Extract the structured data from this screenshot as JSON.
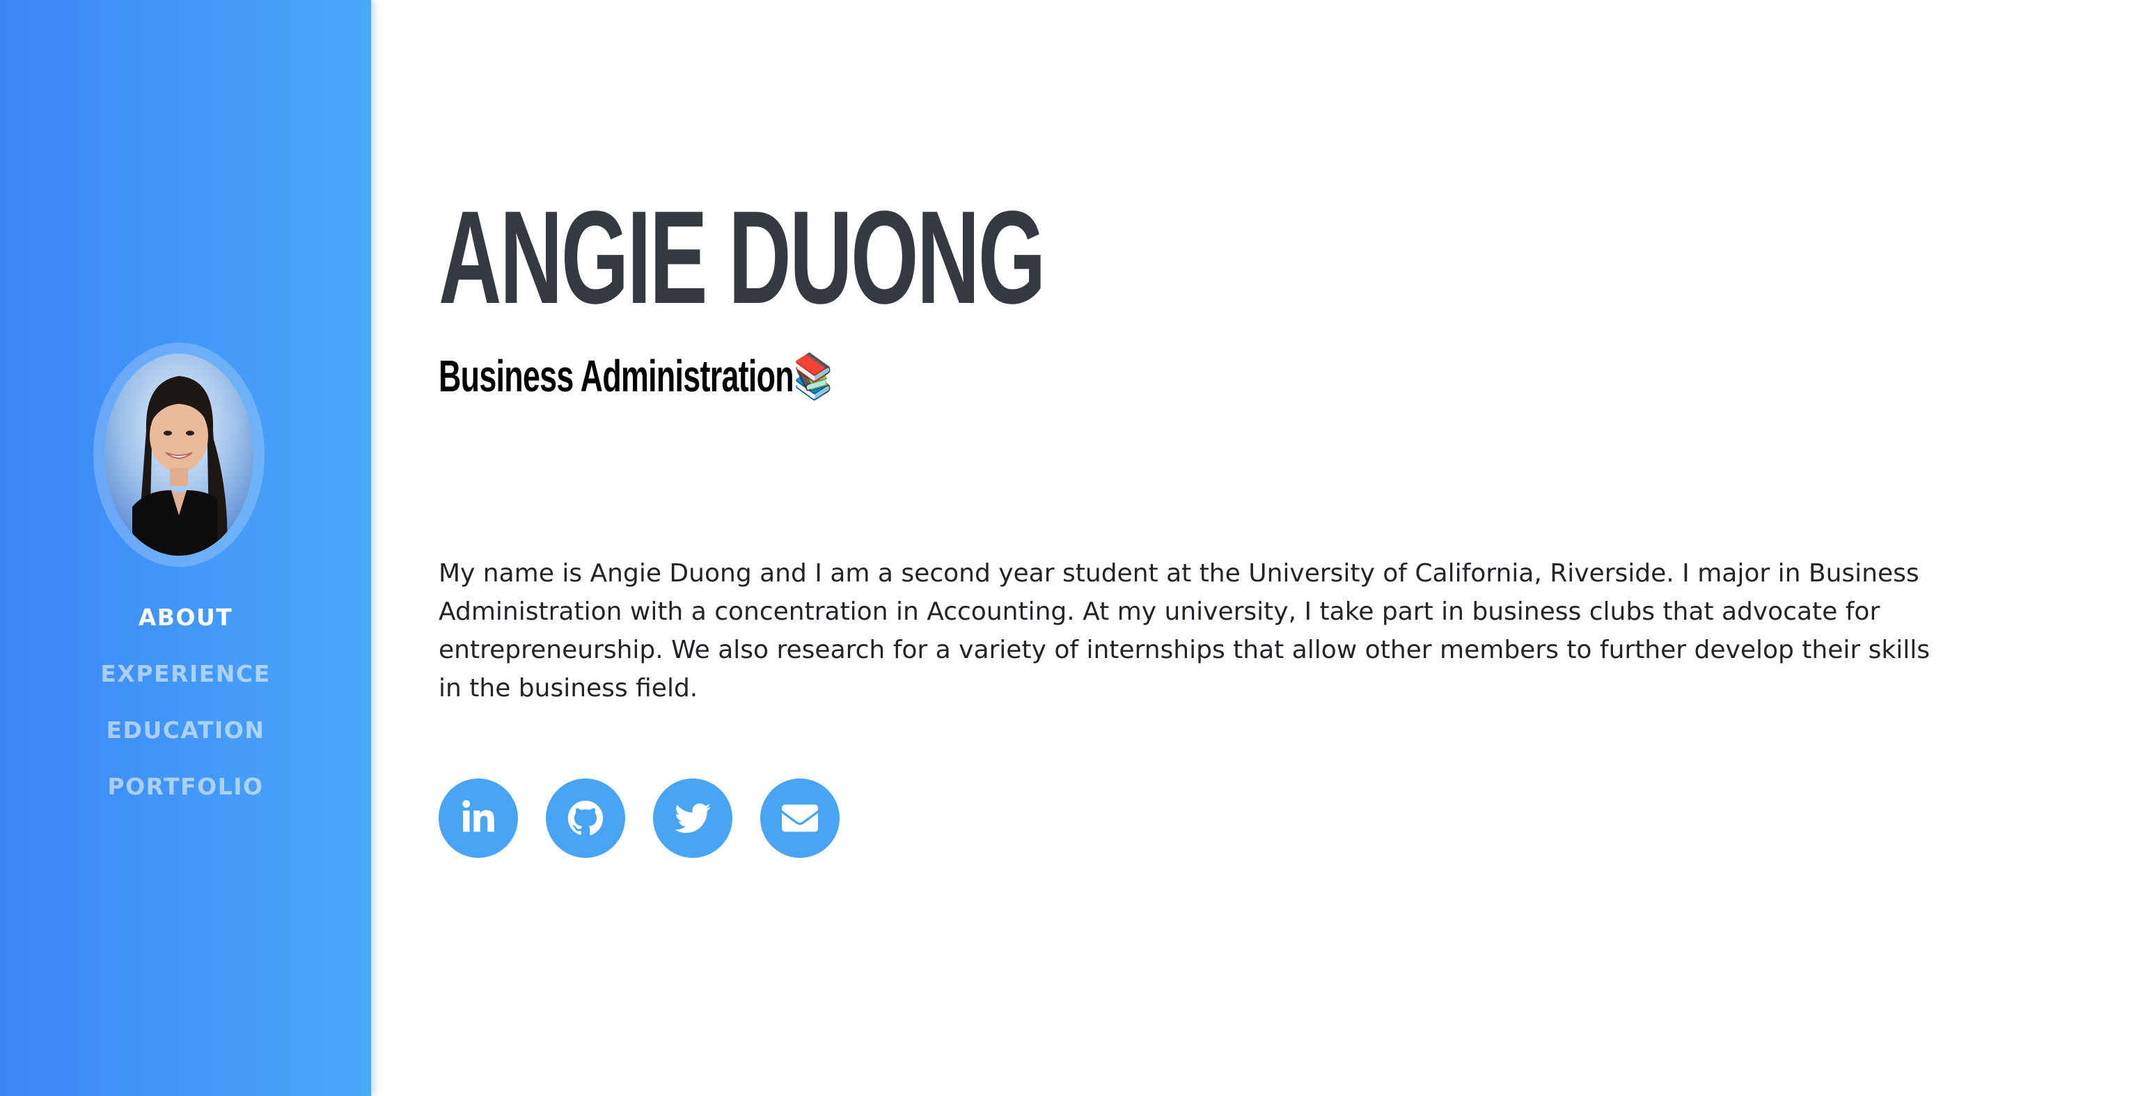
{
  "profile": {
    "name": "ANGIE DUONG",
    "subtitle": "Business Administration",
    "subtitle_emoji": "📚",
    "bio": "My name is Angie Duong and I am a second year student at the University of California, Riverside. I major in Business Administration with a concentration in Accounting. At my university, I take part in business clubs that advocate for entrepreneurship. We also research for a variety of internships that allow other members to further develop their skills in the business field."
  },
  "nav": {
    "items": [
      {
        "label": "ABOUT",
        "active": true
      },
      {
        "label": "EXPERIENCE",
        "active": false
      },
      {
        "label": "EDUCATION",
        "active": false
      },
      {
        "label": "PORTFOLIO",
        "active": false
      }
    ]
  },
  "social": {
    "icons": [
      "linkedin-icon",
      "github-icon",
      "twitter-icon",
      "envelope-icon"
    ]
  },
  "colors": {
    "sidebar_start": "#3b86f7",
    "sidebar_end": "#4aa8f8",
    "social_bg": "#49a4f6",
    "heading": "#343a40"
  }
}
